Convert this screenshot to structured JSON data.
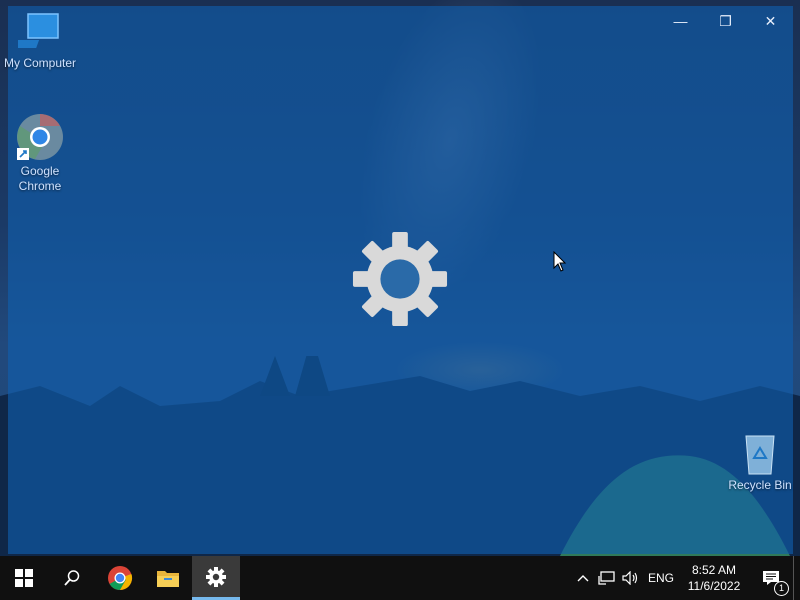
{
  "desktop": {
    "icons": [
      {
        "name": "my-computer",
        "label": "My Computer",
        "icon": "monitor-icon"
      },
      {
        "name": "google-chrome",
        "label": "Google\nChrome",
        "icon": "chrome-icon"
      },
      {
        "name": "recycle-bin",
        "label": "Recycle Bin",
        "icon": "recycle-bin-icon"
      }
    ]
  },
  "app_window": {
    "icon": "gear-icon",
    "controls": {
      "minimize": "—",
      "restore": "❐",
      "close": "✕"
    }
  },
  "taskbar": {
    "buttons": [
      "start-windows-icon",
      "search-icon",
      "chrome-icon",
      "file-explorer-icon",
      "settings-gear-icon"
    ],
    "active": "settings-gear-icon",
    "tray": {
      "language": "ENG",
      "time": "8:52 AM",
      "date": "11/6/2022",
      "notification_count": "1"
    }
  },
  "colors": {
    "overlay": "#105faf",
    "taskbar": "#101010",
    "active_indicator": "#76b9ed"
  }
}
